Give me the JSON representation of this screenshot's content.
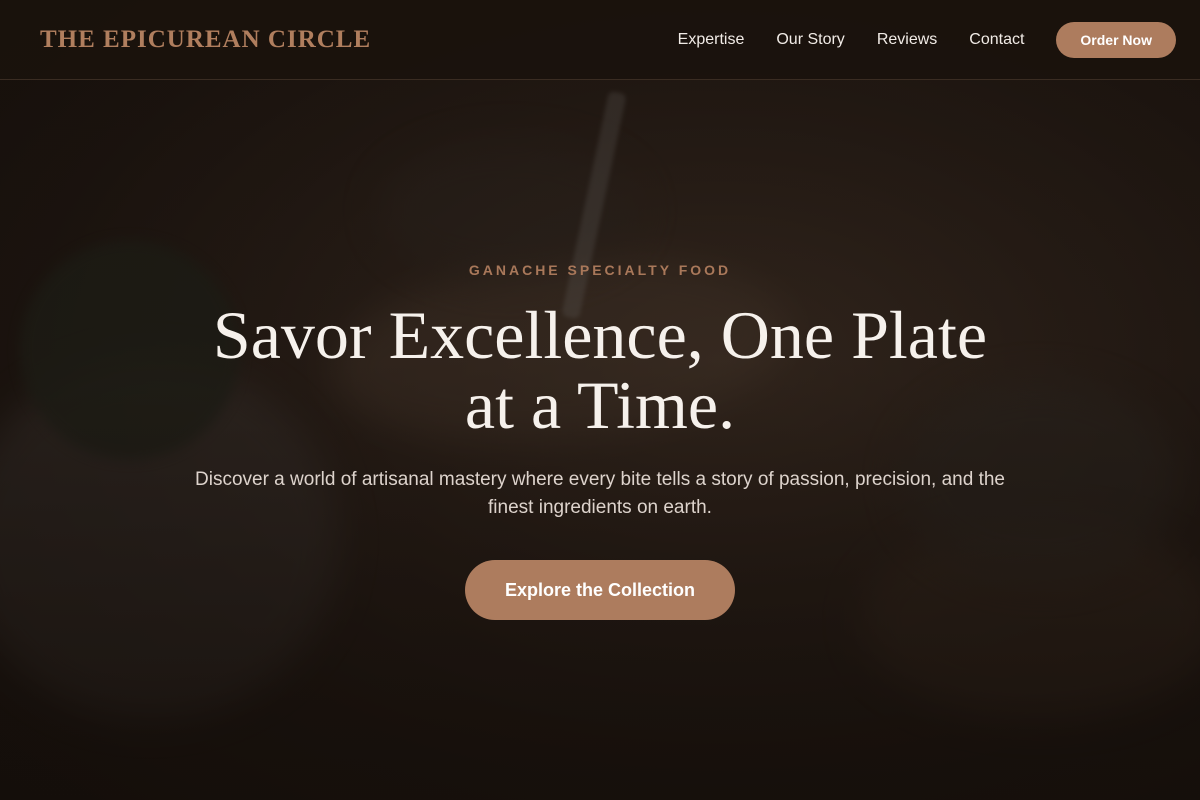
{
  "header": {
    "logo": "THE EPICUREAN CIRCLE",
    "nav": [
      {
        "label": "Expertise"
      },
      {
        "label": "Our Story"
      },
      {
        "label": "Reviews"
      },
      {
        "label": "Contact"
      }
    ],
    "order_label": "Order Now"
  },
  "hero": {
    "eyebrow": "GANACHE SPECIALTY FOOD",
    "headline": "Savor Excellence, One Plate at a Time.",
    "subtext": "Discover a world of artisanal mastery where every bite tells a story of passion, precision, and the finest ingredients on earth.",
    "cta_label": "Explore the Collection"
  },
  "colors": {
    "background": "#1a120d",
    "accent": "#ad7c5e",
    "logo": "#b07e5e",
    "headline": "#f6f1ec"
  }
}
